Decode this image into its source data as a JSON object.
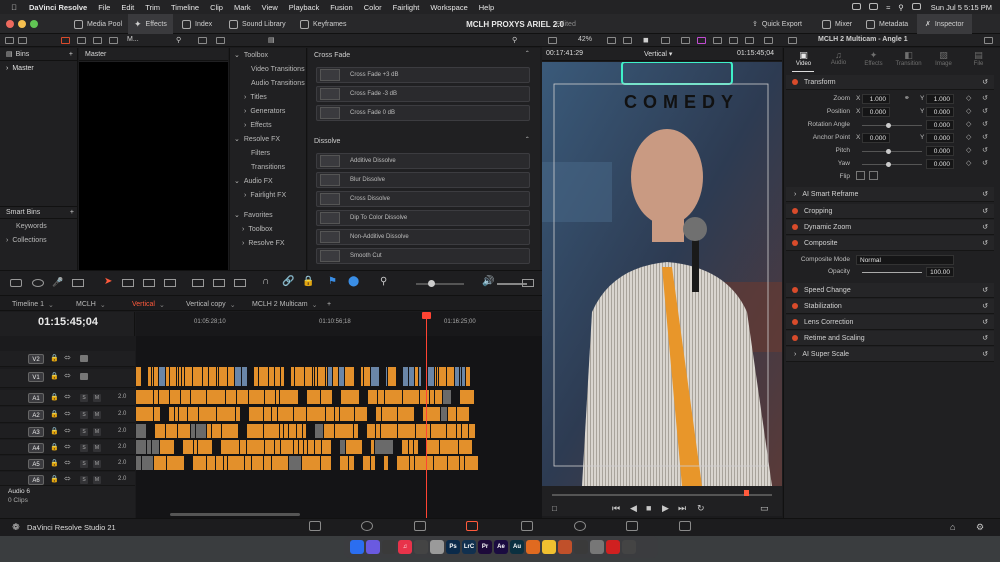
{
  "menubar": {
    "app_name": "DaVinci Resolve",
    "items": [
      "File",
      "Edit",
      "Trim",
      "Timeline",
      "Clip",
      "Mark",
      "View",
      "Playback",
      "Fusion",
      "Color",
      "Fairlight",
      "Workspace",
      "Help"
    ],
    "datetime": "Sun Jul 5  5:15 PM"
  },
  "toolbar": {
    "media_pool": "Media Pool",
    "effects": "Effects",
    "index": "Index",
    "sound_library": "Sound Library",
    "keyframes": "Keyframes",
    "project_title": "MCLH PROXYS ARIEL 2.0",
    "edited": "Edited",
    "quick_export": "Quick Export",
    "mixer": "Mixer",
    "metadata": "Metadata",
    "inspector": "Inspector"
  },
  "subbar": {
    "m_label": "M...",
    "zoom": "42%",
    "timecode_left": "00:17:41:29",
    "clip_name": "Vertical",
    "timecode_right": "01:15:45;04",
    "inspector_clip": "MCLH 2 Multicam - Angle 1"
  },
  "bins": {
    "header": "Bins",
    "items": [
      "Master"
    ],
    "smart_bins_header": "Smart Bins",
    "smart_items": [
      "Keywords",
      "Collections"
    ]
  },
  "media_viewer": {
    "header": "Master"
  },
  "effects_library": {
    "header": "Toolbox",
    "items": [
      {
        "label": "Toolbox",
        "level": 0,
        "expanded": true
      },
      {
        "label": "Video Transitions",
        "level": 1
      },
      {
        "label": "Audio Transitions",
        "level": 1
      },
      {
        "label": "Titles",
        "level": 1
      },
      {
        "label": "Generators",
        "level": 1
      },
      {
        "label": "Effects",
        "level": 1
      },
      {
        "label": "Resolve FX",
        "level": 0,
        "expanded": true
      },
      {
        "label": "Filters",
        "level": 1
      },
      {
        "label": "Transitions",
        "level": 1
      },
      {
        "label": "Audio FX",
        "level": 0,
        "expanded": true
      },
      {
        "label": "Fairlight FX",
        "level": 1
      }
    ],
    "favorites": {
      "label": "Favorites",
      "items": [
        "Toolbox",
        "Resolve FX"
      ]
    }
  },
  "transitions": {
    "cross_fade_header": "Cross Fade",
    "cross_fade": [
      "Cross Fade +3 dB",
      "Cross Fade -3 dB",
      "Cross Fade 0 dB"
    ],
    "dissolve_header": "Dissolve",
    "dissolve": [
      "Additive Dissolve",
      "Blur Dissolve",
      "Cross Dissolve",
      "Dip To Color Dissolve",
      "Non-Additive Dissolve",
      "Smooth Cut"
    ]
  },
  "viewer": {
    "overlay_text": "COMEDY"
  },
  "inspector": {
    "tabs": [
      "Video",
      "Audio",
      "Effects",
      "Transition",
      "Image",
      "File"
    ],
    "transform": {
      "label": "Transform",
      "zoom_label": "Zoom",
      "zoom_x": "1.000",
      "zoom_y": "1.000",
      "position_label": "Position",
      "position_x": "0.000",
      "position_y": "0.000",
      "rotation_label": "Rotation Angle",
      "rotation": "0.000",
      "anchor_label": "Anchor Point",
      "anchor_x": "0.000",
      "anchor_y": "0.000",
      "pitch_label": "Pitch",
      "pitch": "0.000",
      "yaw_label": "Yaw",
      "yaw": "0.000",
      "flip_label": "Flip"
    },
    "sections": [
      {
        "label": "AI Smart Reframe",
        "dot": false
      },
      {
        "label": "Cropping",
        "dot": true
      },
      {
        "label": "Dynamic Zoom",
        "dot": true
      },
      {
        "label": "Composite",
        "dot": true
      },
      {
        "label": "Speed Change",
        "dot": true
      },
      {
        "label": "Stabilization",
        "dot": true
      },
      {
        "label": "Lens Correction",
        "dot": true
      },
      {
        "label": "Retime and Scaling",
        "dot": true
      },
      {
        "label": "AI Super Scale",
        "dot": false
      }
    ],
    "composite_mode_label": "Composite Mode",
    "composite_mode": "Normal",
    "opacity_label": "Opacity",
    "opacity": "100.00"
  },
  "timeline": {
    "tabs": [
      "Timeline 1",
      "MCLH",
      "Vertical",
      "Vertical copy",
      "MCLH 2 Multicam"
    ],
    "active_tab": "Vertical",
    "timecode": "01:15:45;04",
    "ruler": [
      "01:05:28;10",
      "01:10:56;18",
      "01:16:25;00"
    ],
    "tracks": [
      {
        "name": "V2",
        "type": "video"
      },
      {
        "name": "V1",
        "type": "video"
      },
      {
        "name": "A1",
        "type": "audio",
        "level": "2.0"
      },
      {
        "name": "A2",
        "type": "audio",
        "level": "2.0"
      },
      {
        "name": "A3",
        "type": "audio",
        "level": "2.0"
      },
      {
        "name": "A4",
        "type": "audio",
        "level": "2.0"
      },
      {
        "name": "A5",
        "type": "audio",
        "level": "2.0"
      },
      {
        "name": "A6",
        "type": "audio",
        "level": "2.0"
      }
    ],
    "audio6_label": "Audio 6",
    "audio6_clips": "0 Clips"
  },
  "footer": {
    "brand": "DaVinci Resolve Studio 21"
  },
  "dock": {
    "apps": [
      "Ps",
      "LrC",
      "Pr",
      "Ae",
      "Au"
    ]
  }
}
